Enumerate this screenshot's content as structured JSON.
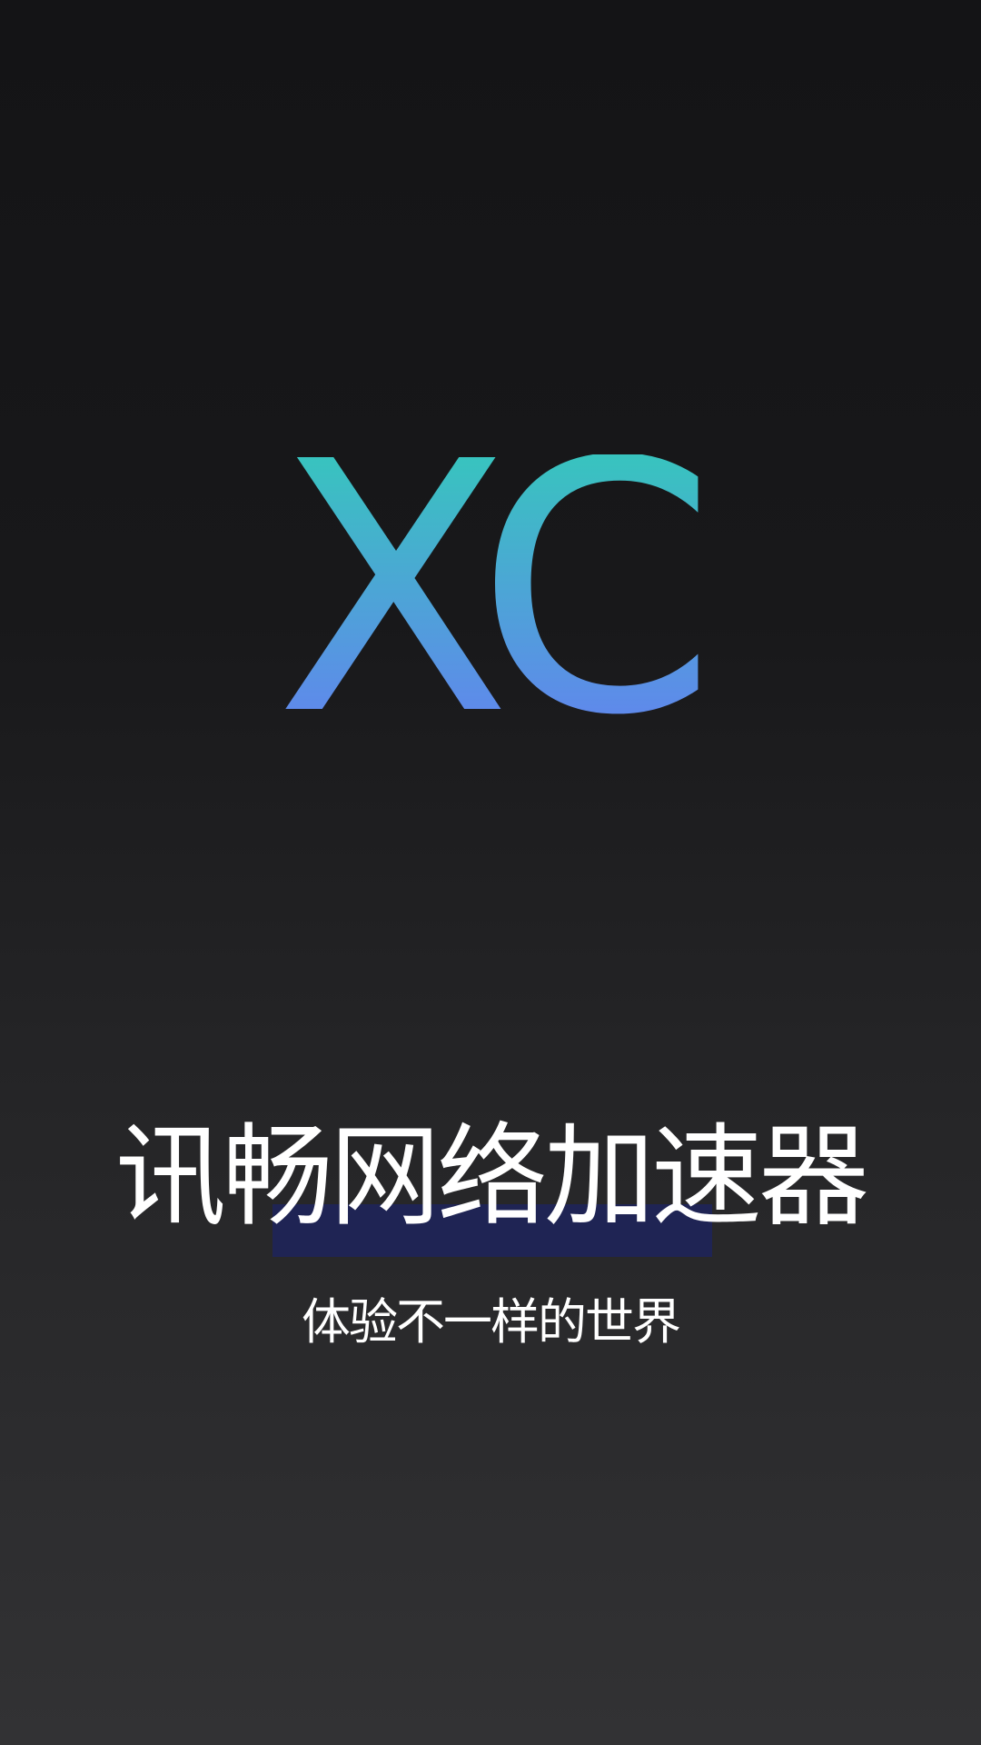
{
  "logo": {
    "text": "XC",
    "gradient_top": "#2ed3b3",
    "gradient_bottom": "#6a78f8"
  },
  "splash": {
    "title": "讯畅网络加速器",
    "tagline": "体验不一样的世界"
  },
  "colors": {
    "background_top": "#141416",
    "background_bottom": "#323234",
    "highlight": "#1f2454",
    "text": "#ffffff"
  }
}
